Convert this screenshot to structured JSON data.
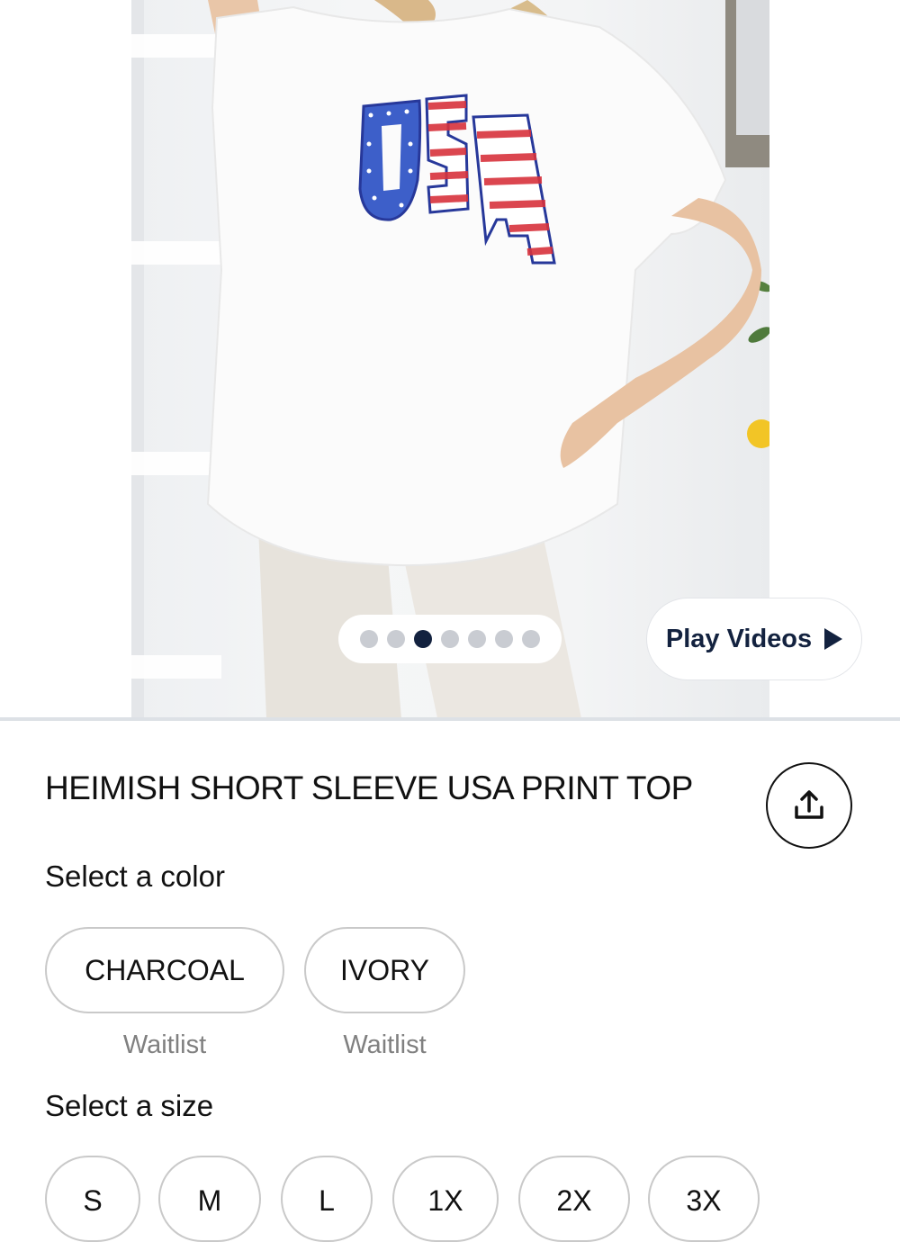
{
  "gallery": {
    "image_count": 7,
    "active_index": 2,
    "shirt_print_text": "USA",
    "play_videos_label": "Play Videos",
    "play_icon": "play-triangle-icon"
  },
  "product": {
    "title": "HEIMISH SHORT SLEEVE USA PRINT TOP",
    "share_icon": "share-upload-icon"
  },
  "color_section": {
    "label": "Select a color",
    "options": [
      {
        "name": "CHARCOAL",
        "status": "Waitlist"
      },
      {
        "name": "IVORY",
        "status": "Waitlist"
      }
    ]
  },
  "size_section": {
    "label": "Select a size",
    "options": [
      "S",
      "M",
      "L",
      "1X",
      "2X",
      "3X"
    ]
  },
  "colors": {
    "navy_accent": "#13223f",
    "inactive_dot": "#c9ccd2",
    "pill_border": "#c9c9c9",
    "muted_text": "#808080"
  }
}
